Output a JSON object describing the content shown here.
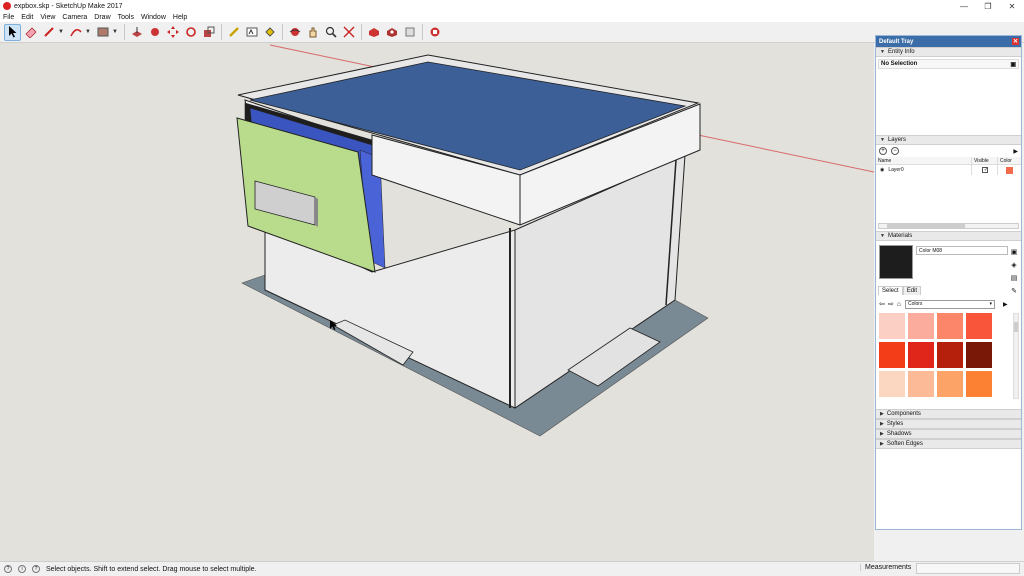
{
  "window": {
    "title": "expbox.skp - SketchUp Make 2017",
    "min": "—",
    "restore": "❐",
    "close": "✕"
  },
  "menu": [
    "File",
    "Edit",
    "View",
    "Camera",
    "Draw",
    "Tools",
    "Window",
    "Help"
  ],
  "toolbar": {
    "tools": [
      "select",
      "eraser",
      "line",
      "arc",
      "shapes",
      "push-pull",
      "follow-me",
      "move",
      "rotate",
      "scale",
      "tape-measure",
      "text",
      "paint-bucket",
      "orbit",
      "pan",
      "zoom",
      "zoom-extents",
      "warehouse",
      "extension-warehouse",
      "layout",
      "extension-manager"
    ]
  },
  "tray": {
    "title": "Default Tray",
    "close": "✕",
    "entity_info": {
      "header": "Entity Info",
      "selection": "No Selection"
    },
    "layers": {
      "header": "Layers",
      "add": "+",
      "remove": "−",
      "col_name": "Name",
      "col_visible": "Visible",
      "col_color": "Color",
      "rows": [
        {
          "name": "Layer0",
          "visible": "✓",
          "color": "#f26b4a"
        }
      ]
    },
    "materials": {
      "header": "Materials",
      "current_name": "Color M08",
      "current_color": "#1d1d1d",
      "tab_select": "Select",
      "tab_edit": "Edit",
      "collection": "Colors",
      "swatches": [
        "#fccfc4",
        "#fcac9c",
        "#fb8669",
        "#f8553a",
        "#f33d18",
        "#e0261a",
        "#b5200d",
        "#7a1808",
        "#fbd7c2",
        "#fcba97",
        "#fca467",
        "#fd8132",
        "#e95b0e",
        "#d8620a",
        "#b94e0c",
        "#7b3104"
      ]
    },
    "collapsed": [
      "Components",
      "Styles",
      "Shadows",
      "Soften Edges"
    ]
  },
  "status": {
    "hint": "Select objects. Shift to extend select. Drag mouse to select multiple.",
    "measurements_label": "Measurements",
    "measurements_value": ""
  }
}
